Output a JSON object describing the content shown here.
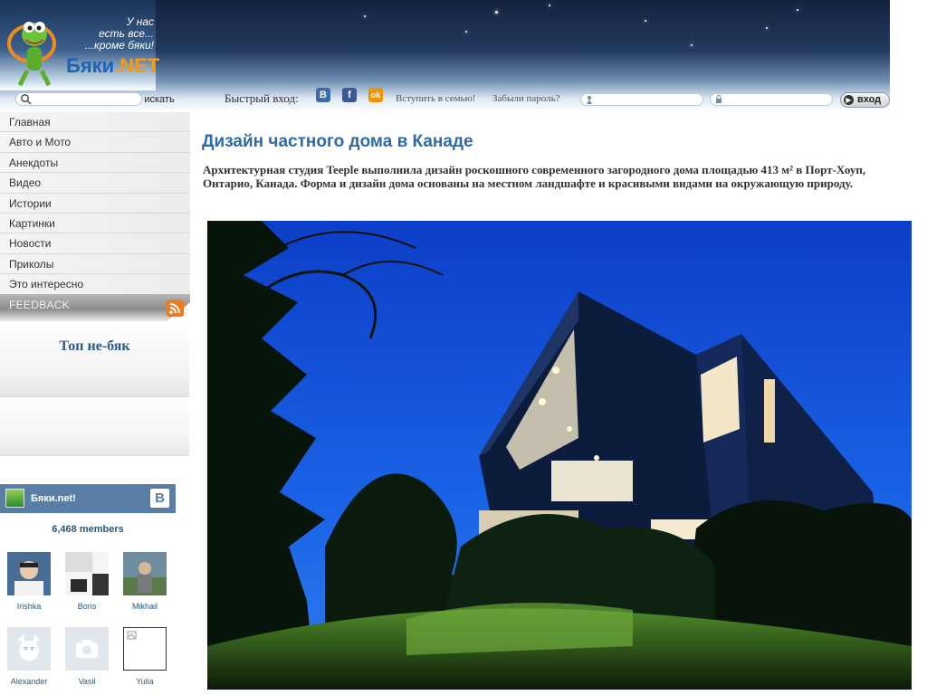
{
  "site": {
    "name_part1": "Бяки",
    "name_part2": ".NET",
    "slogan_line1": "У нас",
    "slogan_line2": "есть все...",
    "slogan_line3": "...кроме бяки!"
  },
  "search": {
    "placeholder": "",
    "button_label": "искать"
  },
  "login": {
    "quick_login_label": "Быстрый вход:",
    "social_buttons": [
      {
        "name": "vkontakte",
        "glyph": "B",
        "color": "#3c6ba5"
      },
      {
        "name": "facebook",
        "glyph": "f",
        "color": "#3b5998"
      },
      {
        "name": "odnoklassniki",
        "glyph": "ok",
        "color": "#f29400"
      }
    ],
    "join_link": "Вступить в семью!",
    "forgot_link": "Забыли пароль?",
    "username_value": "",
    "password_value": "",
    "button_label": "вход"
  },
  "nav": {
    "items": [
      "Главная",
      "Авто и Мото",
      "Анекдоты",
      "Видео",
      "Истории",
      "Картинки",
      "Новости",
      "Приколы",
      "Это интересно"
    ],
    "feedback_label": "FEEDBACK"
  },
  "top_block": {
    "title": "Топ не-бяк"
  },
  "vk_widget": {
    "group_name": "Бяки.net!",
    "logo_glyph": "B",
    "members_count": "6,468 members",
    "members": [
      {
        "name": "Irishka"
      },
      {
        "name": "Boris"
      },
      {
        "name": "Mikhail"
      },
      {
        "name": "Alexander"
      },
      {
        "name": "Vasil"
      },
      {
        "name": "Yulia"
      }
    ]
  },
  "article": {
    "title": "Дизайн частного дома в Канаде",
    "lead": "Архитектурная студия Teeple выполнила дизайн роскошного современного загородного дома площадью 413 м² в Порт-Хоуп, Онтарио, Канада. Форма и дизайн дома основаны на местном ландшафте и красивыми видами на окружающую природу."
  }
}
